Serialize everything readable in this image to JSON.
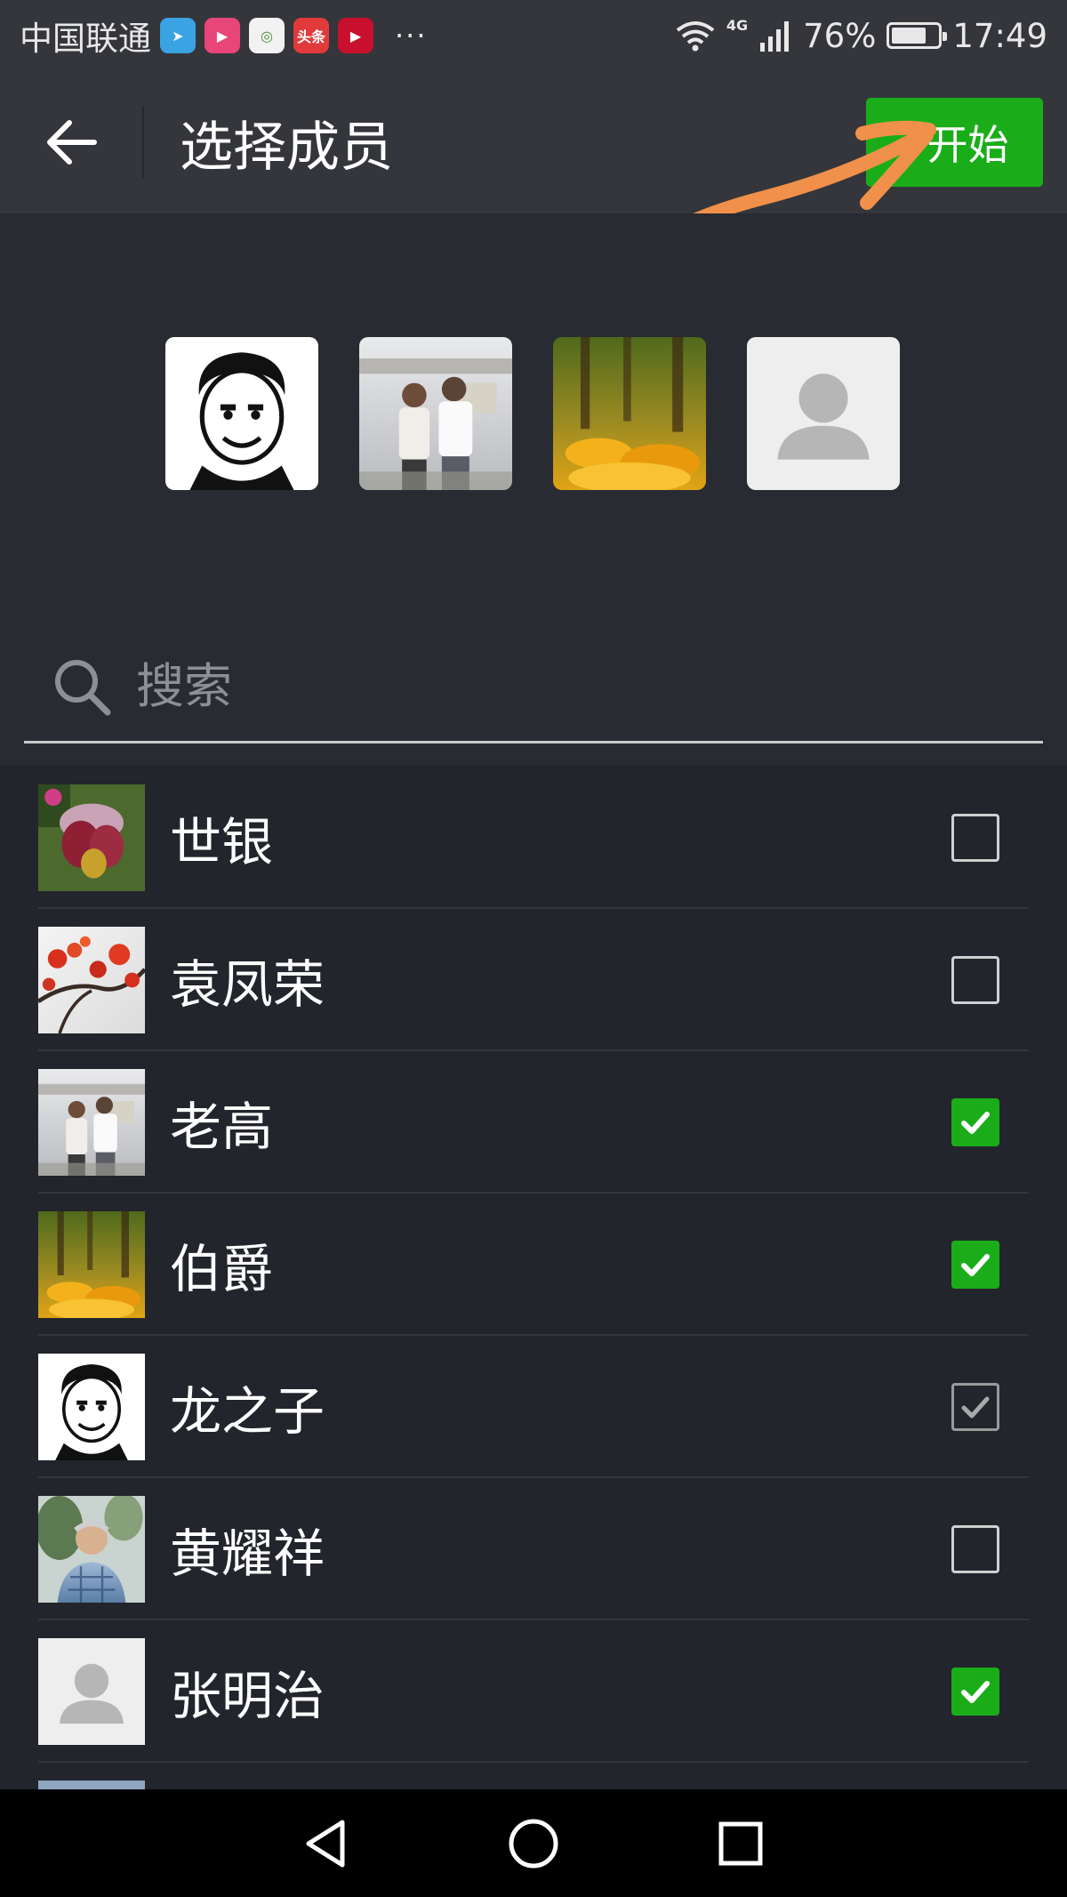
{
  "status_bar": {
    "carrier": "中国联通",
    "apps": [
      {
        "name": "telegram-app-icon",
        "color": "#3aa3e3",
        "glyph": "➤"
      },
      {
        "name": "video-app-icon",
        "color": "#e8457a",
        "glyph": "▶"
      },
      {
        "name": "browser-app-icon",
        "color": "#f2f2f2",
        "glyph": "◎"
      },
      {
        "name": "toutiao-app-icon",
        "color": "#e23a3a",
        "glyph": "头条"
      },
      {
        "name": "music-app-icon",
        "color": "#c8102e",
        "glyph": "▶"
      }
    ],
    "more": "···",
    "network": "4G",
    "battery_percent": "76%",
    "battery_level": 0.76,
    "time": "17:49"
  },
  "app_bar": {
    "title": "选择成员",
    "start_label": "开始"
  },
  "selected_members": [
    {
      "name": "龙之子",
      "avatar": "cartoon-face"
    },
    {
      "name": "老高",
      "avatar": "couple-photo"
    },
    {
      "name": "伯爵",
      "avatar": "autumn-leaves"
    },
    {
      "name": "张明治",
      "avatar": "default-avatar"
    }
  ],
  "search": {
    "placeholder": "搜索",
    "value": ""
  },
  "contacts": [
    {
      "name": "世银",
      "avatar": "orchid-flower",
      "state": "unchecked"
    },
    {
      "name": "袁凤荣",
      "avatar": "red-blossom",
      "state": "unchecked"
    },
    {
      "name": "老高",
      "avatar": "couple-photo",
      "state": "checked"
    },
    {
      "name": "伯爵",
      "avatar": "autumn-leaves",
      "state": "checked"
    },
    {
      "name": "龙之子",
      "avatar": "cartoon-face",
      "state": "disabled-checked"
    },
    {
      "name": "黄耀祥",
      "avatar": "elderly-man-photo",
      "state": "unchecked"
    },
    {
      "name": "张明治",
      "avatar": "default-avatar",
      "state": "checked"
    }
  ],
  "colors": {
    "accent_green": "#1aad19",
    "annotation_arrow": "#f0904a",
    "background": "#23252c"
  }
}
